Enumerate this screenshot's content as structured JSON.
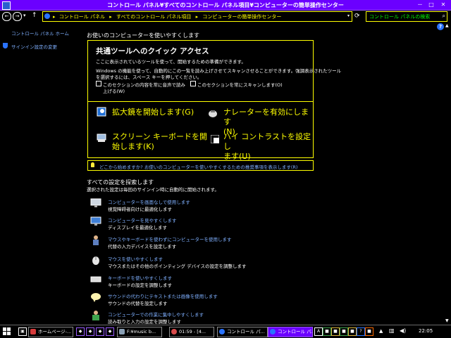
{
  "window": {
    "title": "コントロール パネル¥すべてのコントロール パネル項目¥コンピューターの簡単操作センター",
    "minimize": "－",
    "maximize": "□",
    "close": "✕"
  },
  "nav": {
    "back": "←",
    "forward": "→",
    "recent": "▾",
    "up": "↑",
    "breadcrumb": [
      "コントロール パネル",
      "すべてのコントロール パネル項目",
      "コンピューターの簡単操作センター"
    ],
    "separator": "▸",
    "dropdown": "▾",
    "refresh": "⟳",
    "search_placeholder": "コントロール パネルの検索",
    "search_icon": "⌕"
  },
  "sidebar": {
    "home": "コントロール パネル ホーム",
    "signin": "サインイン設定の変更"
  },
  "main": {
    "heading": "お使いのコンピューターを使いやすくします",
    "quick": {
      "title": "共通ツールへのクイック アクセス",
      "desc1": "ここに表示されているツールを使って、開始するための準備ができます。",
      "desc2": "Windows の機能を使って、自動的にこの一覧を読み上げさせてスキャンさせることができます。強調表示されたツール",
      "desc3": "を選択するには、スペース キーを押してください。",
      "cb1_line1": "このセクションの内容を常に音声で読み",
      "cb1_line2": "上げる(W)",
      "cb2": "このセクションを常にスキャンします(O)",
      "magnifier_l1": "拡大鏡を開始します(G)",
      "narrator_l1": "ナレーターを有効にします",
      "narrator_l2": "(N)",
      "osk_l1": "スクリーン キーボードを開",
      "osk_l2": "始します(K)",
      "contrast_l1": "ハイ コントラストを設定し",
      "contrast_l2": "ます(U)"
    },
    "hint": "どこから始めますか? お使いのコンピューターを使いやすくするための推奨事項を表示します(R)",
    "explore_heading": "すべての設定を探索します",
    "explore_sub": "選択された設定は毎回のサインイン時に自動的に開始されます。",
    "items": [
      {
        "link": "コンピューターを画面なしで使用します",
        "desc": "視覚障碍者向けに最適化します",
        "icon": "monitor-off-icon"
      },
      {
        "link": "コンピューターを見やすくします",
        "desc": "ディスプレイを最適化します",
        "icon": "display-icon"
      },
      {
        "link": "マウスやキーボードを使わずにコンピューターを使用します",
        "desc": "代替の入力デバイスを設定します",
        "icon": "person-input-icon"
      },
      {
        "link": "マウスを使いやすくします",
        "desc": "マウスまたはその他のポインティング デバイスの設定を調整します",
        "icon": "mouse-icon"
      },
      {
        "link": "キーボードを使いやすくします",
        "desc": "キーボードの設定を調整します",
        "icon": "keyboard-icon"
      },
      {
        "link": "サウンドの代わりにテキストまたは画像を使用します",
        "desc": "サウンドの代替を設定します",
        "icon": "speech-bubble-icon"
      },
      {
        "link": "コンピューターでの作業に集中しやすくします",
        "desc": "読み取りと入力の設定を調整します",
        "icon": "focus-icon"
      }
    ]
  },
  "taskbar": {
    "items": [
      "ホームページ-...",
      "F:¥music b...",
      "01:59 - [4...",
      "コントロール パ...",
      "コントロール パ..."
    ],
    "clock": "22:05"
  }
}
